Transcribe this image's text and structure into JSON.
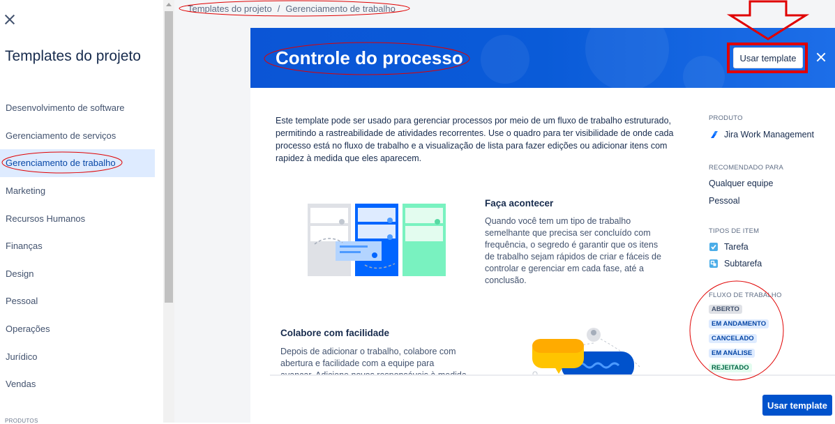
{
  "sidebar": {
    "title": "Templates do projeto",
    "items": [
      {
        "label": "Desenvolvimento de software"
      },
      {
        "label": "Gerenciamento de serviços"
      },
      {
        "label": "Gerenciamento de trabalho",
        "active": true
      },
      {
        "label": "Marketing"
      },
      {
        "label": "Recursos Humanos"
      },
      {
        "label": "Finanças"
      },
      {
        "label": "Design"
      },
      {
        "label": "Pessoal"
      },
      {
        "label": "Operações"
      },
      {
        "label": "Jurídico"
      },
      {
        "label": "Vendas"
      }
    ],
    "footer_label": "PRODUTOS"
  },
  "breadcrumb": {
    "parent": "Templates do projeto",
    "separator": "/",
    "current": "Gerenciamento de trabalho"
  },
  "modal": {
    "title": "Controle do processo",
    "use_template_label": "Usar template",
    "description": "Este template pode ser usado para gerenciar processos por meio de um fluxo de trabalho estruturado, permitindo a rastreabilidade de atividades recorrentes. Use o quadro para ter visibilidade de onde cada processo está no fluxo de trabalho e a visualização de lista para fazer edições ou adicionar itens com rapidez à medida que eles aparecem.",
    "features": [
      {
        "title": "Faça acontecer",
        "text": "Quando você tem um tipo de trabalho semelhante que precisa ser concluído com frequência, o segredo é garantir que os itens de trabalho sejam rápidos de criar e fáceis de controlar e gerenciar em cada fase, até a conclusão."
      },
      {
        "title": "Colabore com facilidade",
        "text": "Depois de adicionar o trabalho, colabore com abertura e facilidade com a equipe para avançar. Adicione novos responsáveis à medida que a"
      }
    ],
    "meta": {
      "product_label": "PRODUTO",
      "product_value": "Jira Work Management",
      "recommended_label": "RECOMENDADO PARA",
      "recommended": [
        "Qualquer equipe",
        "Pessoal"
      ],
      "item_types_label": "TIPOS DE ITEM",
      "item_types": [
        "Tarefa",
        "Subtarefa"
      ],
      "workflow_label": "FLUXO DE TRABALHO",
      "workflow": [
        {
          "label": "ABERTO",
          "color": "#dfe1e6"
        },
        {
          "label": "EM ANDAMENTO",
          "color": "#deebff"
        },
        {
          "label": "CANCELADO",
          "color": "#deebff"
        },
        {
          "label": "EM ANÁLISE",
          "color": "#deebff"
        },
        {
          "label": "REJEITADO",
          "color": "#e3fcef"
        }
      ]
    },
    "use_template_bottom_label": "Usar template"
  },
  "colors": {
    "hero_blue": "#0b55d6",
    "primary_button": "#0052cc",
    "annotation_red": "#e00000",
    "sidebar_active": "#deebff"
  }
}
